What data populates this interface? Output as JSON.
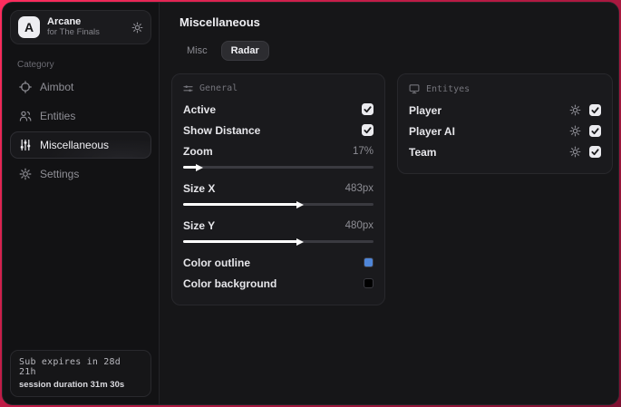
{
  "colors": {
    "accent_outline": "#4f86d8",
    "swatch_background": "#000000"
  },
  "sidebar": {
    "app": {
      "initial": "A",
      "name": "Arcane",
      "subtitle": "for The Finals"
    },
    "category_label": "Category",
    "items": [
      {
        "label": "Aimbot"
      },
      {
        "label": "Entities"
      },
      {
        "label": "Miscellaneous"
      },
      {
        "label": "Settings"
      }
    ],
    "footer": {
      "line1": "Sub expires in 28d 21h",
      "line2": "session duration 31m 30s"
    }
  },
  "main": {
    "title": "Miscellaneous",
    "tabs": [
      {
        "label": "Misc"
      },
      {
        "label": "Radar"
      }
    ],
    "general": {
      "header": "General",
      "rows": {
        "active": {
          "label": "Active",
          "checked": true
        },
        "show_distance": {
          "label": "Show Distance",
          "checked": true
        },
        "zoom": {
          "label": "Zoom",
          "value": "17%",
          "fill_pct": 7
        },
        "size_x": {
          "label": "Size X",
          "value": "483px",
          "fill_pct": 60
        },
        "size_y": {
          "label": "Size Y",
          "value": "480px",
          "fill_pct": 60
        },
        "color_outline": {
          "label": "Color outline",
          "color": "#4f86d8"
        },
        "color_background": {
          "label": "Color background",
          "color": "#000000"
        }
      }
    },
    "entities": {
      "header": "Entityes",
      "rows": [
        {
          "label": "Player",
          "checked": true
        },
        {
          "label": "Player AI",
          "checked": true
        },
        {
          "label": "Team",
          "checked": true
        }
      ]
    }
  }
}
